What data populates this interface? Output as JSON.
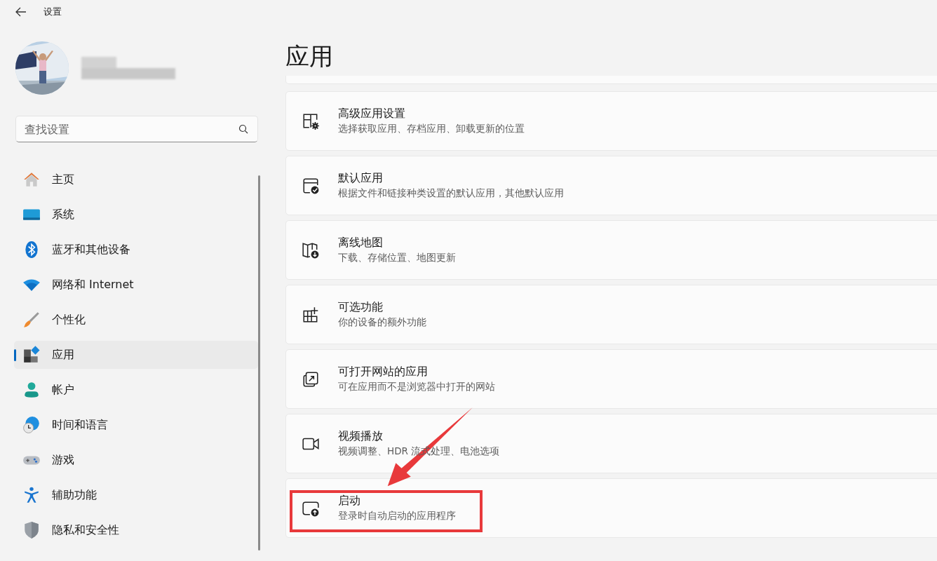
{
  "window": {
    "title": "设置"
  },
  "search": {
    "placeholder": "查找设置"
  },
  "sidebar": {
    "items": [
      {
        "label": "主页",
        "selected": false
      },
      {
        "label": "系统",
        "selected": false
      },
      {
        "label": "蓝牙和其他设备",
        "selected": false
      },
      {
        "label": "网络和 Internet",
        "selected": false
      },
      {
        "label": "个性化",
        "selected": false
      },
      {
        "label": "应用",
        "selected": true
      },
      {
        "label": "帐户",
        "selected": false
      },
      {
        "label": "时间和语言",
        "selected": false
      },
      {
        "label": "游戏",
        "selected": false
      },
      {
        "label": "辅助功能",
        "selected": false
      },
      {
        "label": "隐私和安全性",
        "selected": false
      }
    ]
  },
  "page": {
    "title": "应用",
    "cards": [
      {
        "title": "高级应用设置",
        "description": "选择获取应用、存档应用、卸载更新的位置",
        "highlighted": false
      },
      {
        "title": "默认应用",
        "description": "根据文件和链接种类设置的默认应用，其他默认应用",
        "highlighted": false
      },
      {
        "title": "离线地图",
        "description": "下载、存储位置、地图更新",
        "highlighted": false
      },
      {
        "title": "可选功能",
        "description": "你的设备的额外功能",
        "highlighted": false
      },
      {
        "title": "可打开网站的应用",
        "description": "可在应用而不是浏览器中打开的网站",
        "highlighted": false
      },
      {
        "title": "视频播放",
        "description": "视频调整、HDR 流式处理、电池选项",
        "highlighted": false
      },
      {
        "title": "启动",
        "description": "登录时自动启动的应用程序",
        "highlighted": true
      }
    ]
  }
}
